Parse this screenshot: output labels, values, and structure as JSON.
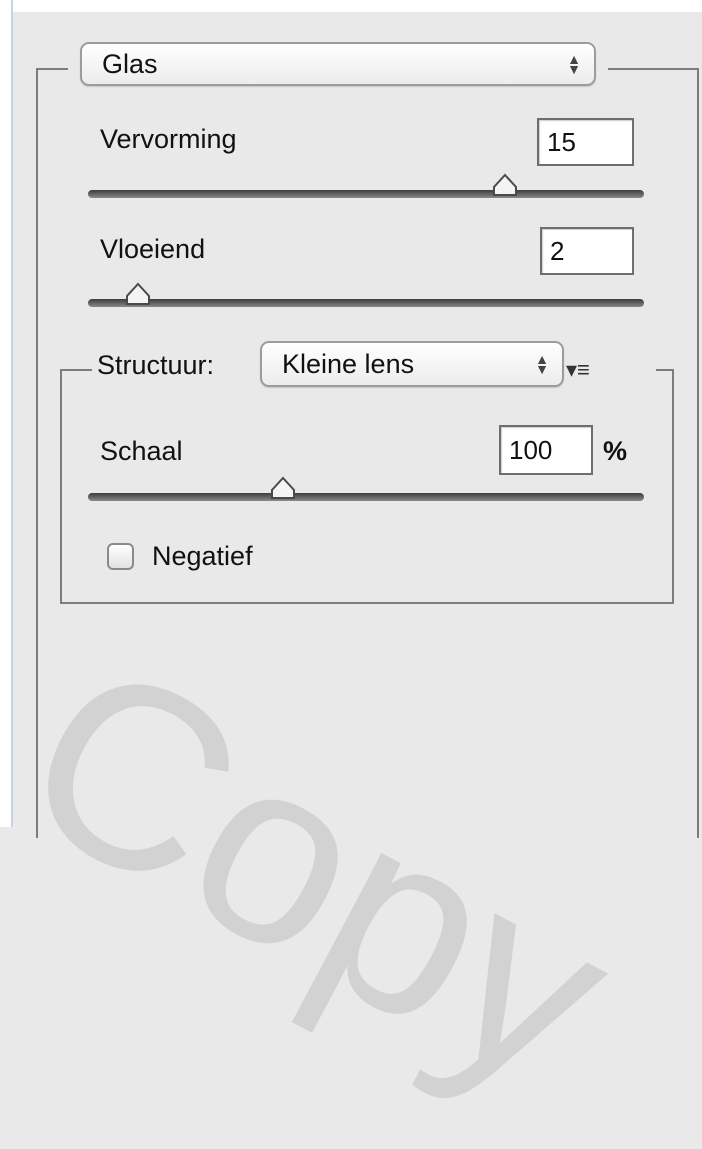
{
  "filter_select": {
    "value": "Glas"
  },
  "distortion": {
    "label": "Vervorming",
    "value": "15",
    "level_pct": 75
  },
  "smoothness": {
    "label": "Vloeiend",
    "value": "2",
    "level_pct": 9
  },
  "texture": {
    "label": "Structuur:",
    "value": "Kleine lens",
    "menu_glyph": "▾≡",
    "scale": {
      "label": "Schaal",
      "value": "100",
      "unit": "%",
      "level_pct": 35
    },
    "invert": {
      "label": "Negatief",
      "checked": false
    }
  },
  "watermark": {
    "text": "Copy"
  }
}
